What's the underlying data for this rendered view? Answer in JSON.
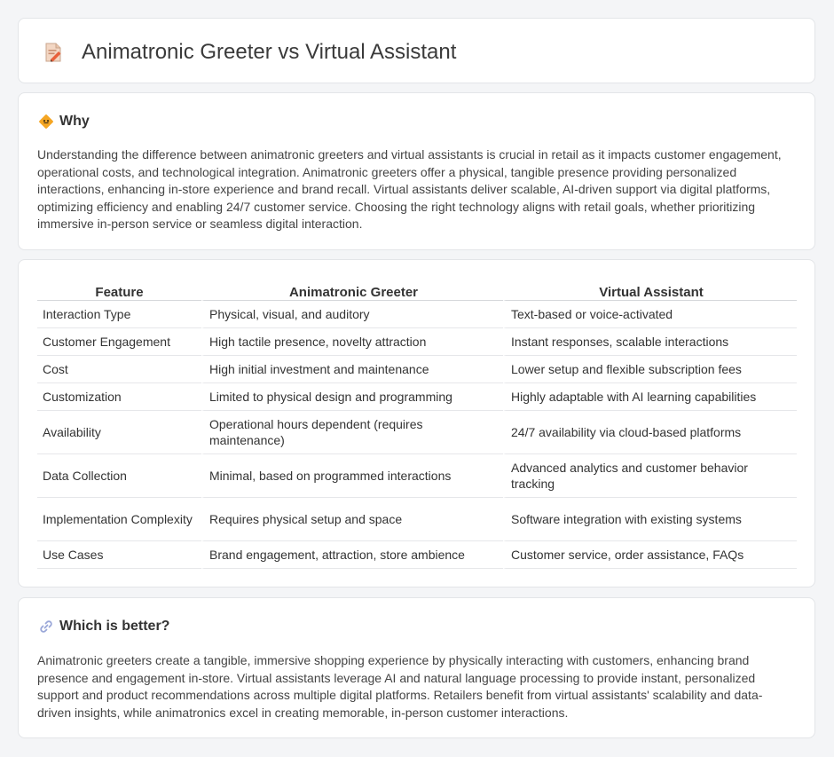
{
  "header": {
    "title": "Animatronic Greeter vs Virtual Assistant",
    "icon": "document-pencil-icon"
  },
  "why": {
    "icon": "diamond-sign-icon",
    "heading": "Why",
    "text": "Understanding the difference between animatronic greeters and virtual assistants is crucial in retail as it impacts customer engagement, operational costs, and technological integration. Animatronic greeters offer a physical, tangible presence providing personalized interactions, enhancing in-store experience and brand recall. Virtual assistants deliver scalable, AI-driven support via digital platforms, optimizing efficiency and enabling 24/7 customer service. Choosing the right technology aligns with retail goals, whether prioritizing immersive in-person service or seamless digital interaction."
  },
  "table": {
    "headers": [
      "Feature",
      "Animatronic Greeter",
      "Virtual Assistant"
    ],
    "rows": [
      [
        "Interaction Type",
        "Physical, visual, and auditory",
        "Text-based or voice-activated"
      ],
      [
        "Customer Engagement",
        "High tactile presence, novelty attraction",
        "Instant responses, scalable interactions"
      ],
      [
        "Cost",
        "High initial investment and maintenance",
        "Lower setup and flexible subscription fees"
      ],
      [
        "Customization",
        "Limited to physical design and programming",
        "Highly adaptable with AI learning capabilities"
      ],
      [
        "Availability",
        "Operational hours dependent (requires maintenance)",
        "24/7 availability via cloud-based platforms"
      ],
      [
        "Data Collection",
        "Minimal, based on programmed interactions",
        "Advanced analytics and customer behavior tracking"
      ],
      [
        "Implementation Complexity",
        "Requires physical setup and space",
        "Software integration with existing systems"
      ],
      [
        "Use Cases",
        "Brand engagement, attraction, store ambience",
        "Customer service, order assistance, FAQs"
      ]
    ]
  },
  "better": {
    "icon": "link-icon",
    "heading": "Which is better?",
    "text": "Animatronic greeters create a tangible, immersive shopping experience by physically interacting with customers, enhancing brand presence and engagement in-store. Virtual assistants leverage AI and natural language processing to provide instant, personalized support and product recommendations across multiple digital platforms. Retailers benefit from virtual assistants' scalability and data-driven insights, while animatronics excel in creating memorable, in-person customer interactions."
  },
  "colors": {
    "background": "#f4f5f7",
    "card": "#ffffff",
    "diamond_icon": "#f5a623",
    "link_icon": "#9aa7d8"
  }
}
